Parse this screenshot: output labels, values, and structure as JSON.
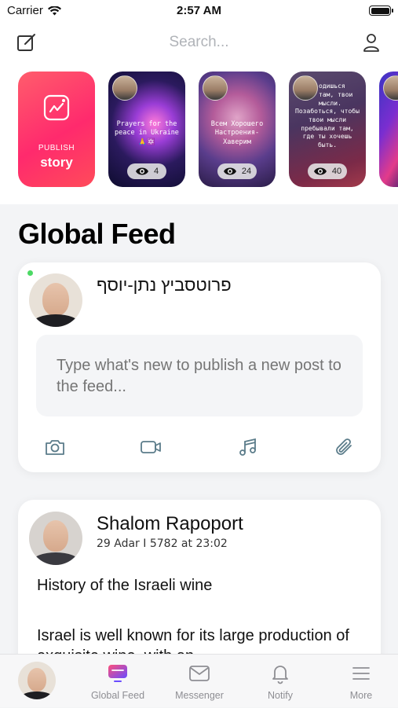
{
  "status_bar": {
    "carrier": "Carrier",
    "time": "2:57 AM"
  },
  "header": {
    "search_placeholder": "Search...",
    "icons": [
      "compose-icon",
      "profile-icon"
    ]
  },
  "stories": {
    "publish": {
      "small": "PUBLISH",
      "big": "story"
    },
    "items": [
      {
        "caption": "Prayers for the peace in Ukraine 🙏🔯",
        "views": "4"
      },
      {
        "caption": "Всем Хорошего Настроения-Хаверим",
        "views": "24"
      },
      {
        "caption_top": "одишься там, твои мысли.",
        "caption_mid": "Позаботься, чтобы твои мысли пребывали там, где ты хочешь быть.",
        "views": "40"
      }
    ]
  },
  "feed": {
    "title": "Global Feed"
  },
  "composer": {
    "name": "פרוטסביץ נתן-יוסף",
    "placeholder": "Type what's new to publish a new post to the feed...",
    "tools": [
      "camera-icon",
      "video-icon",
      "music-icon",
      "attach-icon"
    ]
  },
  "post": {
    "author": "Shalom Rapoport",
    "date": "29 Adar I 5782 at 23:02",
    "title": "History of the Israeli wine",
    "body": "Israel is well known for its large production of exquisite wine, with an"
  },
  "tabbar": {
    "tabs": [
      {
        "label": "Global Feed",
        "icon": "feed-icon",
        "active": true
      },
      {
        "label": "Messenger",
        "icon": "envelope-icon",
        "active": false
      },
      {
        "label": "Notify",
        "icon": "bell-icon",
        "active": false
      },
      {
        "label": "More",
        "icon": "menu-icon",
        "active": false
      }
    ]
  },
  "colors": {
    "accent": "#ff2a6d",
    "icon": "#5b7c8a",
    "online": "#4cd964"
  }
}
